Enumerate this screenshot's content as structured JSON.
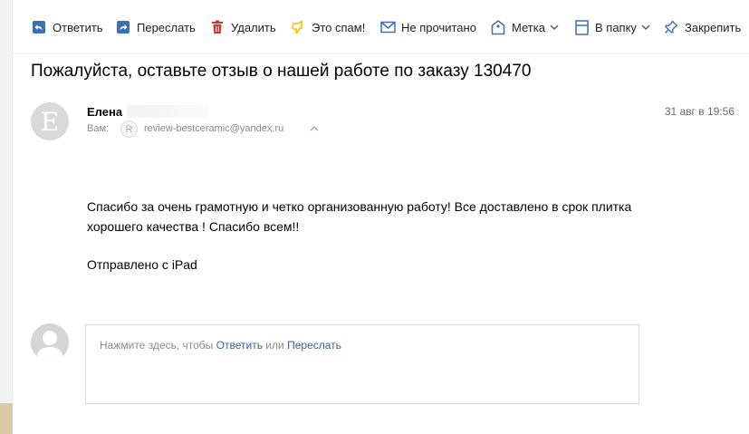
{
  "toolbar": {
    "reply": {
      "label": "Ответить",
      "icon": "reply-icon"
    },
    "forward": {
      "label": "Переслать",
      "icon": "forward-icon"
    },
    "delete": {
      "label": "Удалить",
      "icon": "trash-icon"
    },
    "spam": {
      "label": "Это спам!",
      "icon": "thumbs-down-icon"
    },
    "unread": {
      "label": "Не прочитано",
      "icon": "envelope-icon"
    },
    "label": {
      "label": "Метка",
      "icon": "tag-icon"
    },
    "folder": {
      "label": "В папку",
      "icon": "folder-icon"
    },
    "pin": {
      "label": "Закрепить",
      "icon": "pin-icon"
    }
  },
  "message": {
    "subject": "Пожалуйста, оставьте отзыв о нашей работе по заказу 130470",
    "sender_initial": "Е",
    "sender_name": "Елена",
    "to_label": "Вам:",
    "to_badge": "R",
    "to_email": "review-bestceramic@yandex.ru",
    "date": "31 авг в 19:56",
    "body_line1": "Спасибо за очень грамотную и четко организованную работу! Все доставлено в срок плитка",
    "body_line2": "хорошего качества ! Спасибо всем!!",
    "signature": "Отправлено с iPad"
  },
  "reply": {
    "hint_prefix": "Нажмите здесь, чтобы",
    "reply_link": "Ответить",
    "hint_or": "или",
    "forward_link": "Переслать"
  },
  "colors": {
    "icon_blue": "#3d6fb6",
    "delete_red": "#d9302c",
    "spam_yellow": "#f5c400",
    "link": "#3d5f9e"
  }
}
